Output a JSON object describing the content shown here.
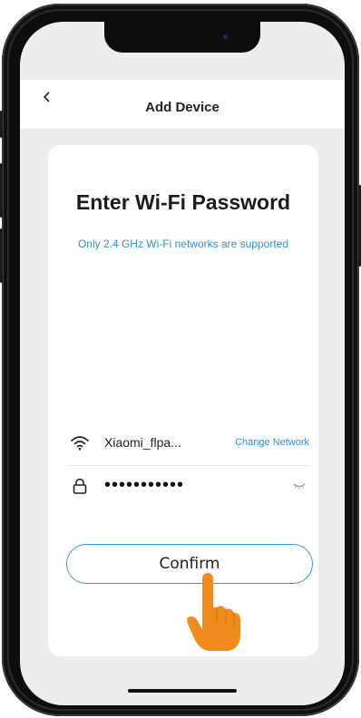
{
  "header": {
    "title": "Add Device"
  },
  "main": {
    "heading": "Enter Wi-Fi Password",
    "subtitle": "Only 2.4 GHz Wi-Fi networks are supported",
    "wifi": {
      "ssid": "Xiaomi_flpa...",
      "change_label": "Change Network"
    },
    "password": {
      "masked_value": "•••••••••••"
    },
    "confirm_label": "Confirm"
  },
  "icons": {
    "back": "chevron-left-icon",
    "wifi": "wifi-icon",
    "lock": "lock-icon",
    "visibility": "eye-closed-icon",
    "pointer": "pointing-hand-icon"
  },
  "colors": {
    "accent": "#2f8fd8",
    "hand": "#f08c1e",
    "background": "#ededed"
  }
}
